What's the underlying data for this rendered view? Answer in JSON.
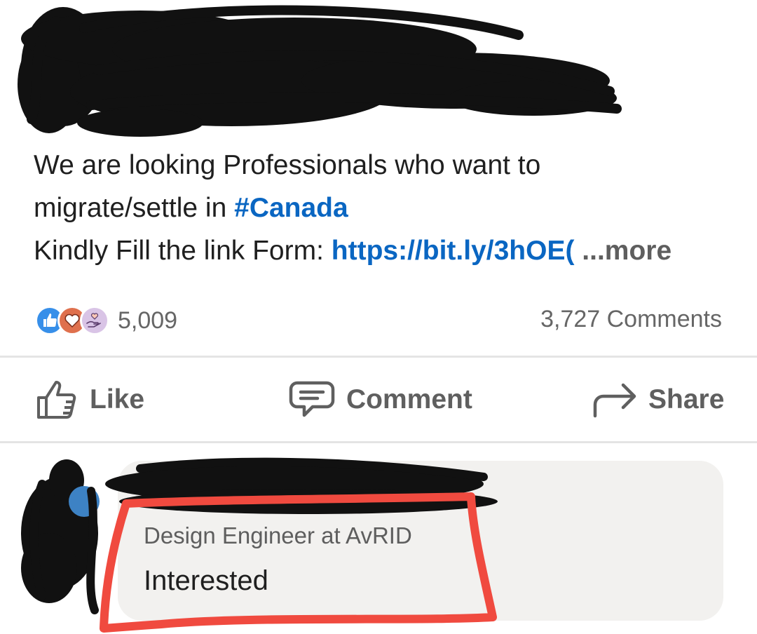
{
  "post": {
    "line1": "We are looking Professionals who want to",
    "line2_prefix": "migrate/settle in ",
    "hashtag": "#Canada",
    "line3_prefix": "Kindly Fill the link Form: ",
    "link": "https://bit.ly/3hOE(",
    "more": "...more"
  },
  "social": {
    "reaction_count": "5,009",
    "comments_count": "3,727 Comments",
    "reaction_icons": [
      "like-icon",
      "love-icon",
      "support-icon"
    ]
  },
  "actions": {
    "like": "Like",
    "comment": "Comment",
    "share": "Share"
  },
  "comment": {
    "headline": "Design Engineer at AvRID",
    "text": "Interested"
  },
  "colors": {
    "link": "#0a66c2",
    "like": "#378fe9",
    "love": "#df704d",
    "support": "#c4a3d8",
    "annotation": "#f04a3f"
  }
}
